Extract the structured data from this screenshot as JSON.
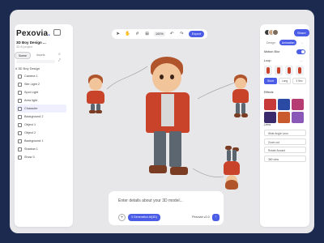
{
  "app": {
    "logo": "Pexovia",
    "project_title": "3D Boy Design ...",
    "project_sub": "3D AI project"
  },
  "left_panel": {
    "tabs": [
      "Scene",
      "Assets"
    ],
    "section_title": "# 3D Boy Design",
    "layers": [
      {
        "label": "Camera 1",
        "icon": "camera-icon"
      },
      {
        "label": "Site Light 2",
        "icon": "light-icon"
      },
      {
        "label": "Spot Light",
        "icon": "spot-light-icon"
      },
      {
        "label": "Area light",
        "icon": "area-light-icon"
      },
      {
        "label": "Character",
        "icon": "character-icon",
        "selected": true
      },
      {
        "label": "Background 2",
        "icon": "background-icon"
      },
      {
        "label": "Object 1",
        "icon": "object-icon"
      },
      {
        "label": "Object 2",
        "icon": "object-icon"
      },
      {
        "label": "Background 1",
        "icon": "background-icon"
      },
      {
        "label": "Shadow 1",
        "icon": "shadow-icon"
      },
      {
        "label": "Show 3",
        "icon": "show-icon"
      }
    ]
  },
  "toolbar": {
    "tools": [
      "select-tool",
      "hand-tool",
      "frame-tool",
      "grid-tool"
    ],
    "zoom": "100%",
    "export_label": "Export"
  },
  "prompt": {
    "placeholder": "Enter details about your 3D model...",
    "model_label": "3 Generation AI(3D)",
    "version": "Pexovia v2.0"
  },
  "right_panel": {
    "share_label": "Share",
    "tabs": [
      "Design",
      "Animation",
      "..."
    ],
    "motion_blur_label": "Motion Blur",
    "motion_blur_on": true,
    "loop_label": "Loop",
    "loop_options": [
      "Short",
      "Long",
      "3 Sec"
    ],
    "effects_label": "Effects",
    "effect_colors": [
      "#c63a3a",
      "#2a4aa3",
      "#b63c74",
      "#3a2a6c",
      "#c95a2e",
      "#8a58b6"
    ],
    "lens_label": "Lens",
    "lens_items": [
      "Wide Angle Lens",
      "Zoom out",
      "Rotate Around",
      "360 view"
    ],
    "accent": "#4b5ce6"
  }
}
